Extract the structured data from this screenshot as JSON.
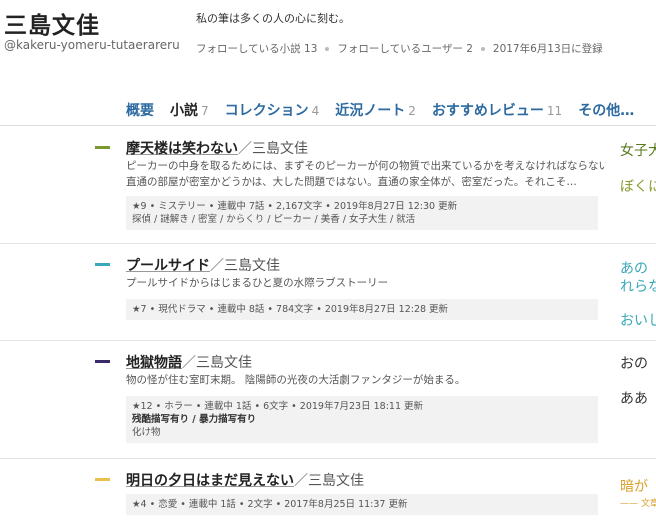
{
  "user": {
    "name": "三島文佳",
    "id": "@kakeru-yomeru-tutaerareru",
    "bio": "私の筆は多くの人の心に刻む。",
    "following_novels": "フォローしている小説 13",
    "following_users": "フォローしているユーザー 2",
    "registered": "2017年6月13日に登録"
  },
  "tabs": [
    {
      "label": "概要",
      "count": ""
    },
    {
      "label": "小説",
      "count": "7"
    },
    {
      "label": "コレクション",
      "count": "4"
    },
    {
      "label": "近況ノート",
      "count": "2"
    },
    {
      "label": "おすすめレビュー",
      "count": "11"
    },
    {
      "label": "その他…",
      "count": ""
    }
  ],
  "works": [
    {
      "title": "摩天楼は笑わない",
      "slash": "／",
      "author": "三島文佳",
      "color": "#7a9a2e",
      "desc1": "ピーカーの中身を取るためには、まずそのピーカーが何の物質で出来ているかを考えなければならない。",
      "desc2": "直通の部屋が密室かどうかは、大した問題ではない。直通の家全体が、密室だった。それこそ…",
      "meta": "★9 • ミステリー • 連載中 7話 • 2,167文字 • 2019年8月27日 12:30 更新",
      "warn": "",
      "tags": "探偵 / 謎解き / 密室 / からくり / ピーカー / 美香 / 女子大生 / 就活"
    },
    {
      "title": "プールサイド",
      "slash": "／",
      "author": "三島文佳",
      "color": "#3aa8b8",
      "desc1": "プールサイドからはじまるひと夏の水際ラブストーリー",
      "desc2": "",
      "meta": "★7 • 現代ドラマ • 連載中 8話 • 784文字 • 2019年8月27日 12:28 更新",
      "warn": "",
      "tags": ""
    },
    {
      "title": "地獄物語",
      "slash": "／",
      "author": "三島文佳",
      "color": "#3a2a6a",
      "desc1": "物の怪が住む室町末期。 陰陽師の光夜の大活劇ファンタジーが始まる。",
      "desc2": "",
      "meta": "★12 • ホラー • 連載中 1話 • 6文字 • 2019年7月23日 18:11 更新",
      "warn": "残酷描写有り / 暴力描写有り",
      "tags": "化け物"
    },
    {
      "title": "明日の夕日はまだ見えない",
      "slash": "／",
      "author": "三島文佳",
      "color": "#e8c04a",
      "desc1": "",
      "desc2": "",
      "meta": "★4 • 恋愛 • 連載中 1話 • 2文字 • 2017年8月25日 11:37 更新",
      "warn": "",
      "tags": ""
    }
  ],
  "side": [
    {
      "text": "女子大",
      "color": "#5a7a1e"
    },
    {
      "text": "ぼくに",
      "color": "#8a9a2e"
    },
    {
      "text": "あの",
      "color": "#3aa8b8"
    },
    {
      "text": "れらな",
      "color": "#3aa8b8"
    },
    {
      "text": "おいし",
      "color": "#3aa8b8"
    },
    {
      "text": "おの",
      "color": "#333333"
    },
    {
      "text": "ああ",
      "color": "#333333"
    },
    {
      "text": "暗が",
      "color": "#d8a030"
    },
    {
      "text": "—— 文章",
      "color": "#d8a030"
    }
  ]
}
